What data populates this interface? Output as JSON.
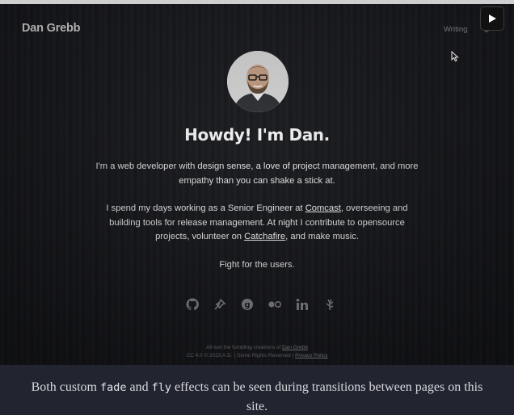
{
  "site": {
    "brand": "Dan Grebb",
    "nav": {
      "writing_label": "Writing"
    }
  },
  "hero": {
    "headline": "Howdy! I'm Dan.",
    "intro": "I'm a web developer with design sense, a love of project management, and more empathy than you can shake a stick at.",
    "work_prefix": "I spend my days working as a Senior Engineer at ",
    "work_link": "Comcast",
    "work_middle": ", overseeing and building tools for release management. At night I contribute to opensource projects, volunteer on ",
    "volunteer_link": "Catchafire",
    "work_suffix": ", and make music.",
    "motto": "Fight for the users."
  },
  "socials": [
    {
      "name": "github-icon"
    },
    {
      "name": "pin-icon"
    },
    {
      "name": "goodreads-icon"
    },
    {
      "name": "flickr-icon"
    },
    {
      "name": "linkedin-icon"
    },
    {
      "name": "leaf-icon"
    }
  ],
  "footer": {
    "line1_prefix": "All text the fumbling creations of ",
    "line1_link": "Dan Grebb",
    "line2_prefix": "CC 4.0 ",
    "line2_mid": " 2023 A.D. | Some Rights Reserved | ",
    "line2_link": "Privacy Policy"
  },
  "caption": {
    "before": "Both custom ",
    "code1": "fade",
    "middle": " and ",
    "code2": "fly",
    "after": " effects can be seen during transitions between pages on this site."
  }
}
